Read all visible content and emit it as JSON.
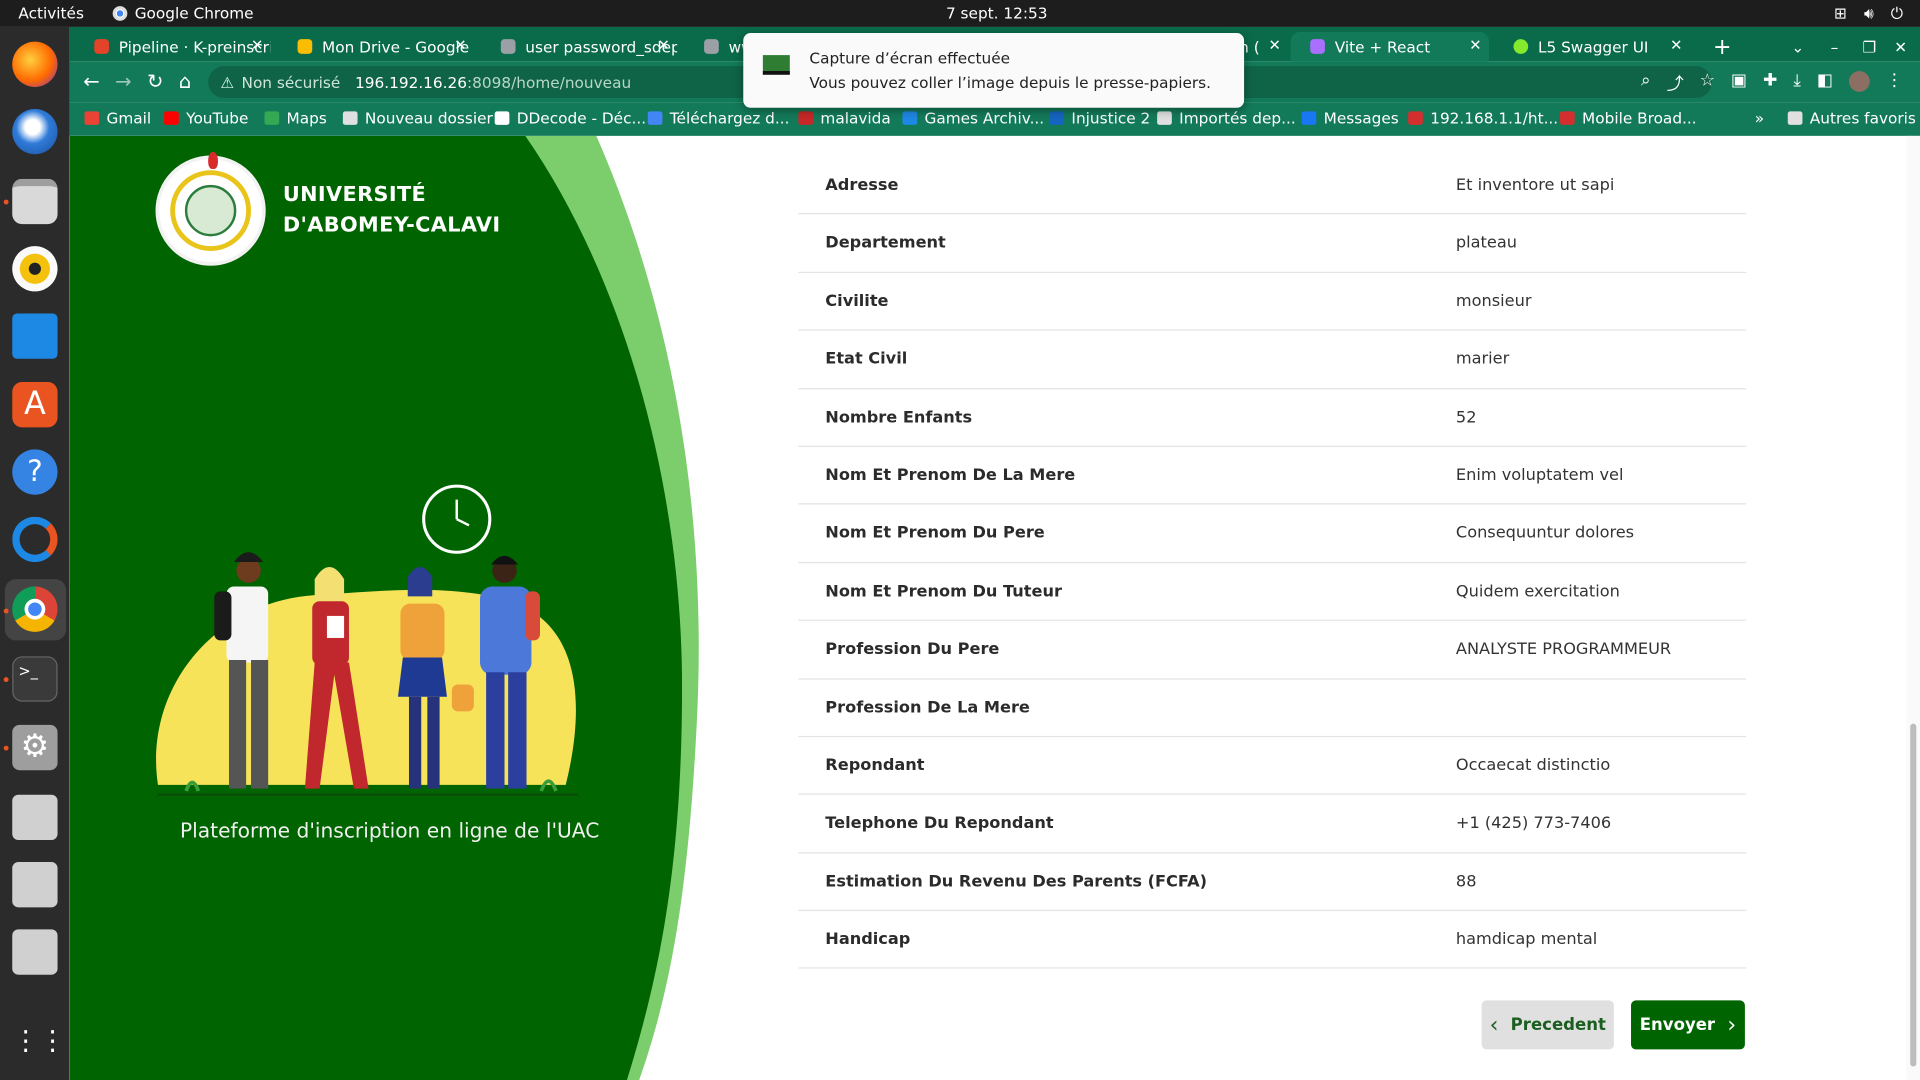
{
  "os": {
    "activities": "Activités",
    "app_name": "Google Chrome",
    "clock": "7 sept.  12:53"
  },
  "tabs": [
    {
      "label": "Pipeline · K-preinscri",
      "color": "#e24329"
    },
    {
      "label": "Mon Drive - Google D",
      "color": "#fbbc04"
    },
    {
      "label": "user password_sdep",
      "color": "#9aa0a6"
    },
    {
      "label": "ww",
      "color": "#9aa0a6"
    },
    {
      "label": "n (",
      "color": "#9aa0a6"
    },
    {
      "label": "Vite + React",
      "color": "#a970ff"
    },
    {
      "label": "L5 Swagger UI",
      "color": "#85ea2d"
    }
  ],
  "address": {
    "warning": "Non sécurisé",
    "host": "196.192.16.26",
    "path": ":8098/home/nouveau"
  },
  "bookmarks": [
    {
      "label": "Gmail",
      "color": "#ea4335"
    },
    {
      "label": "YouTube",
      "color": "#ff0000"
    },
    {
      "label": "Maps",
      "color": "#34a853"
    },
    {
      "label": "Nouveau dossier",
      "color": "#e0e0e0"
    },
    {
      "label": "DDecode - Déc...",
      "color": "#ffffff"
    },
    {
      "label": "Téléchargez d...",
      "color": "#4285f4"
    },
    {
      "label": "malavida",
      "color": "#c62828"
    },
    {
      "label": "Games Archiv...",
      "color": "#1e88e5"
    },
    {
      "label": "Injustice 2",
      "color": "#1565c0"
    },
    {
      "label": "Importés dep...",
      "color": "#e0e0e0"
    },
    {
      "label": "Messages",
      "color": "#1877f2"
    },
    {
      "label": "192.168.1.1/ht...",
      "color": "#d32f2f"
    },
    {
      "label": "Mobile Broad...",
      "color": "#d32f2f"
    }
  ],
  "bookmarks_more": "»",
  "other_bookmarks": "Autres favoris",
  "notification": {
    "title": "Capture d’écran effectuée",
    "body": "Vous pouvez coller l’image depuis le presse-papiers."
  },
  "university": {
    "line1": "UNIVERSITÉ",
    "line2": "D'ABOMEY-CALAVI",
    "tagline": "Plateforme d'inscription en ligne de l'UAC"
  },
  "details": [
    {
      "label": "Adresse",
      "value": "Et inventore ut sapi"
    },
    {
      "label": "Departement",
      "value": "plateau"
    },
    {
      "label": "Civilite",
      "value": "monsieur"
    },
    {
      "label": "Etat Civil",
      "value": "marier"
    },
    {
      "label": "Nombre Enfants",
      "value": "52"
    },
    {
      "label": "Nom Et Prenom De La Mere",
      "value": "Enim voluptatem vel"
    },
    {
      "label": "Nom Et Prenom Du Pere",
      "value": "Consequuntur dolores"
    },
    {
      "label": "Nom Et Prenom Du Tuteur",
      "value": "Quidem exercitation"
    },
    {
      "label": "Profession Du Pere",
      "value": "ANALYSTE PROGRAMMEUR"
    },
    {
      "label": "Profession De La Mere",
      "value": ""
    },
    {
      "label": "Repondant",
      "value": "Occaecat distinctio"
    },
    {
      "label": "Telephone Du Repondant",
      "value": "+1 (425) 773-7406"
    },
    {
      "label": "Estimation Du Revenu Des Parents (FCFA)",
      "value": "88"
    },
    {
      "label": "Handicap",
      "value": "hamdicap mental"
    }
  ],
  "buttons": {
    "previous": "Precedent",
    "submit": "Envoyer"
  },
  "colors": {
    "brand_green": "#006400",
    "light_green": "#7ccd6b",
    "chrome_green": "#137a59"
  }
}
